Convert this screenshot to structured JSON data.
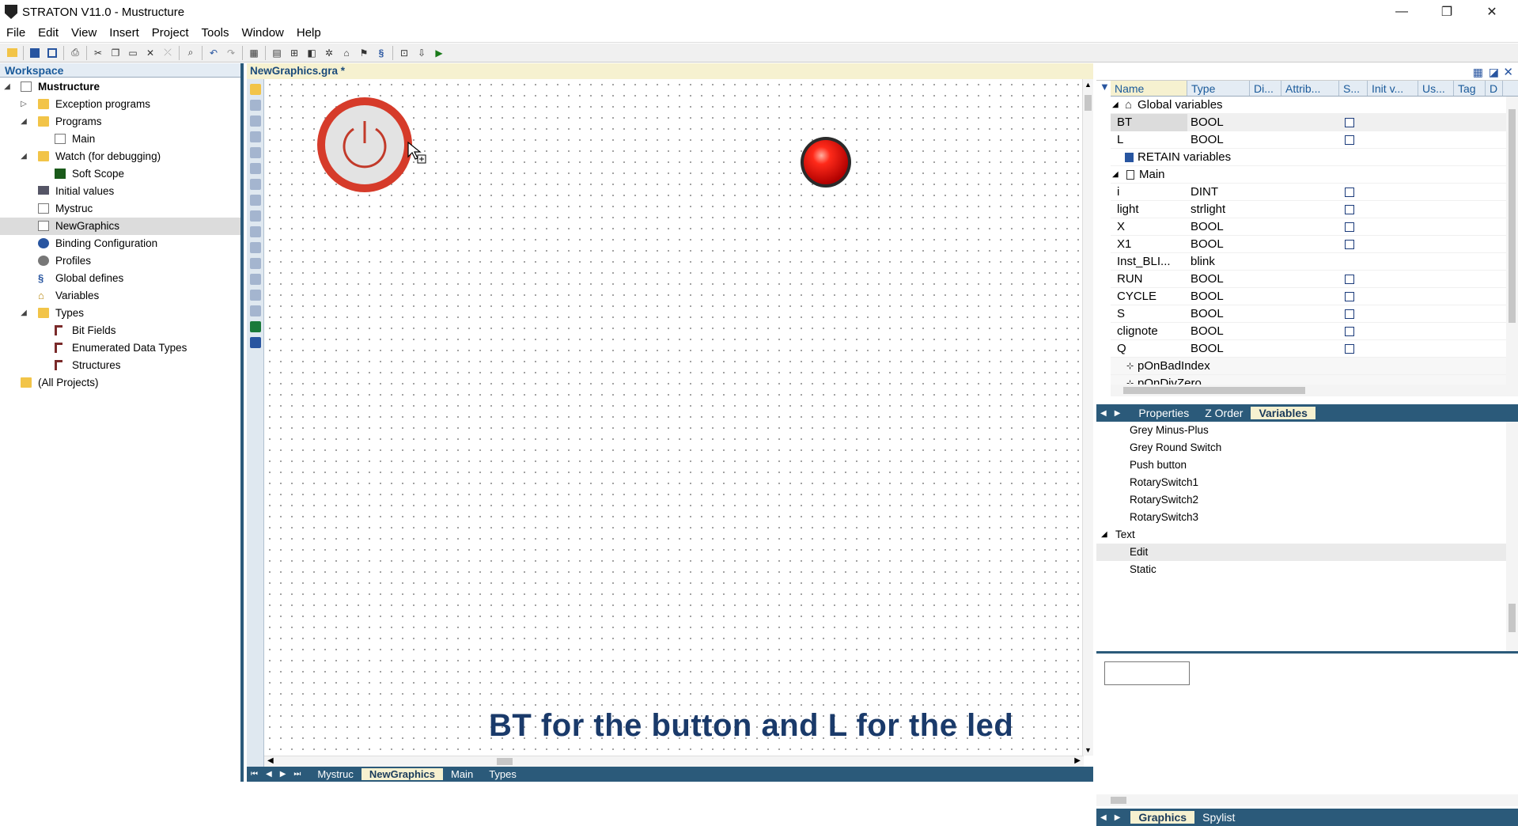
{
  "window": {
    "title": "STRATON V11.0 - Mustructure",
    "minimize": "—",
    "restore": "❐",
    "close": "✕"
  },
  "menu": [
    "File",
    "Edit",
    "View",
    "Insert",
    "Project",
    "Tools",
    "Window",
    "Help"
  ],
  "workspace": {
    "header": "Workspace",
    "tree": [
      {
        "label": "Mustructure",
        "bold": true
      },
      {
        "label": "Exception programs"
      },
      {
        "label": "Programs"
      },
      {
        "label": "Main"
      },
      {
        "label": "Watch (for debugging)"
      },
      {
        "label": "Soft Scope"
      },
      {
        "label": "Initial values"
      },
      {
        "label": "Mystruc"
      },
      {
        "label": "NewGraphics",
        "selected": true
      },
      {
        "label": "Binding Configuration"
      },
      {
        "label": "Profiles"
      },
      {
        "label": "Global defines"
      },
      {
        "label": "Variables"
      },
      {
        "label": "Types"
      },
      {
        "label": "Bit Fields"
      },
      {
        "label": "Enumerated Data Types"
      },
      {
        "label": "Structures"
      },
      {
        "label": "(All Projects)"
      }
    ]
  },
  "editor": {
    "tab_title": "NewGraphics.gra *",
    "bottom_tabs": [
      "Mystruc",
      "NewGraphics",
      "Main",
      "Types"
    ],
    "active_tab": "NewGraphics",
    "caption": "BT for the button and L for the led",
    "colors": {
      "button_ring": "#d63b2a",
      "button_face": "#e3e3e3",
      "led": "#e01010"
    }
  },
  "variables": {
    "columns": [
      "Name",
      "Type",
      "Di...",
      "Attrib...",
      "S...",
      "Init v...",
      "Us...",
      "Tag",
      "D"
    ],
    "rows": [
      {
        "kind": "group",
        "name": "Global variables"
      },
      {
        "name": "BT",
        "type": "BOOL",
        "check": true,
        "selected": true
      },
      {
        "name": "L",
        "type": "BOOL",
        "check": true
      },
      {
        "kind": "subgroup",
        "name": "RETAIN variables"
      },
      {
        "kind": "group",
        "name": "Main"
      },
      {
        "name": "i",
        "type": "DINT",
        "check": true
      },
      {
        "name": "light",
        "type": "strlight",
        "check": true
      },
      {
        "name": "X",
        "type": "BOOL",
        "check": true
      },
      {
        "name": "X1",
        "type": "BOOL",
        "check": true
      },
      {
        "name": "Inst_BLI...",
        "type": "blink",
        "check": false
      },
      {
        "name": "RUN",
        "type": "BOOL",
        "check": true
      },
      {
        "name": "CYCLE",
        "type": "BOOL",
        "check": true
      },
      {
        "name": "S",
        "type": "BOOL",
        "check": true
      },
      {
        "name": "clignote",
        "type": "BOOL",
        "check": true
      },
      {
        "name": "Q",
        "type": "BOOL",
        "check": true
      },
      {
        "kind": "sub",
        "name": "pOnBadIndex"
      },
      {
        "kind": "sub",
        "name": "pOnDivZero"
      }
    ]
  },
  "pane_tabs": [
    "Properties",
    "Z Order",
    "Variables"
  ],
  "pane_active": "Variables",
  "library": [
    {
      "label": "Grey Minus-Plus",
      "indent": 1
    },
    {
      "label": "Grey Round Switch",
      "indent": 1
    },
    {
      "label": "Push button",
      "indent": 1
    },
    {
      "label": "RotarySwitch1",
      "indent": 1
    },
    {
      "label": "RotarySwitch2",
      "indent": 1
    },
    {
      "label": "RotarySwitch3",
      "indent": 1
    },
    {
      "label": "Text",
      "indent": 0
    },
    {
      "label": "Edit",
      "indent": 1,
      "selected": true
    },
    {
      "label": "Static",
      "indent": 1
    }
  ],
  "right_bottom_tabs": [
    "Graphics",
    "Spylist"
  ],
  "right_bottom_active": "Graphics"
}
